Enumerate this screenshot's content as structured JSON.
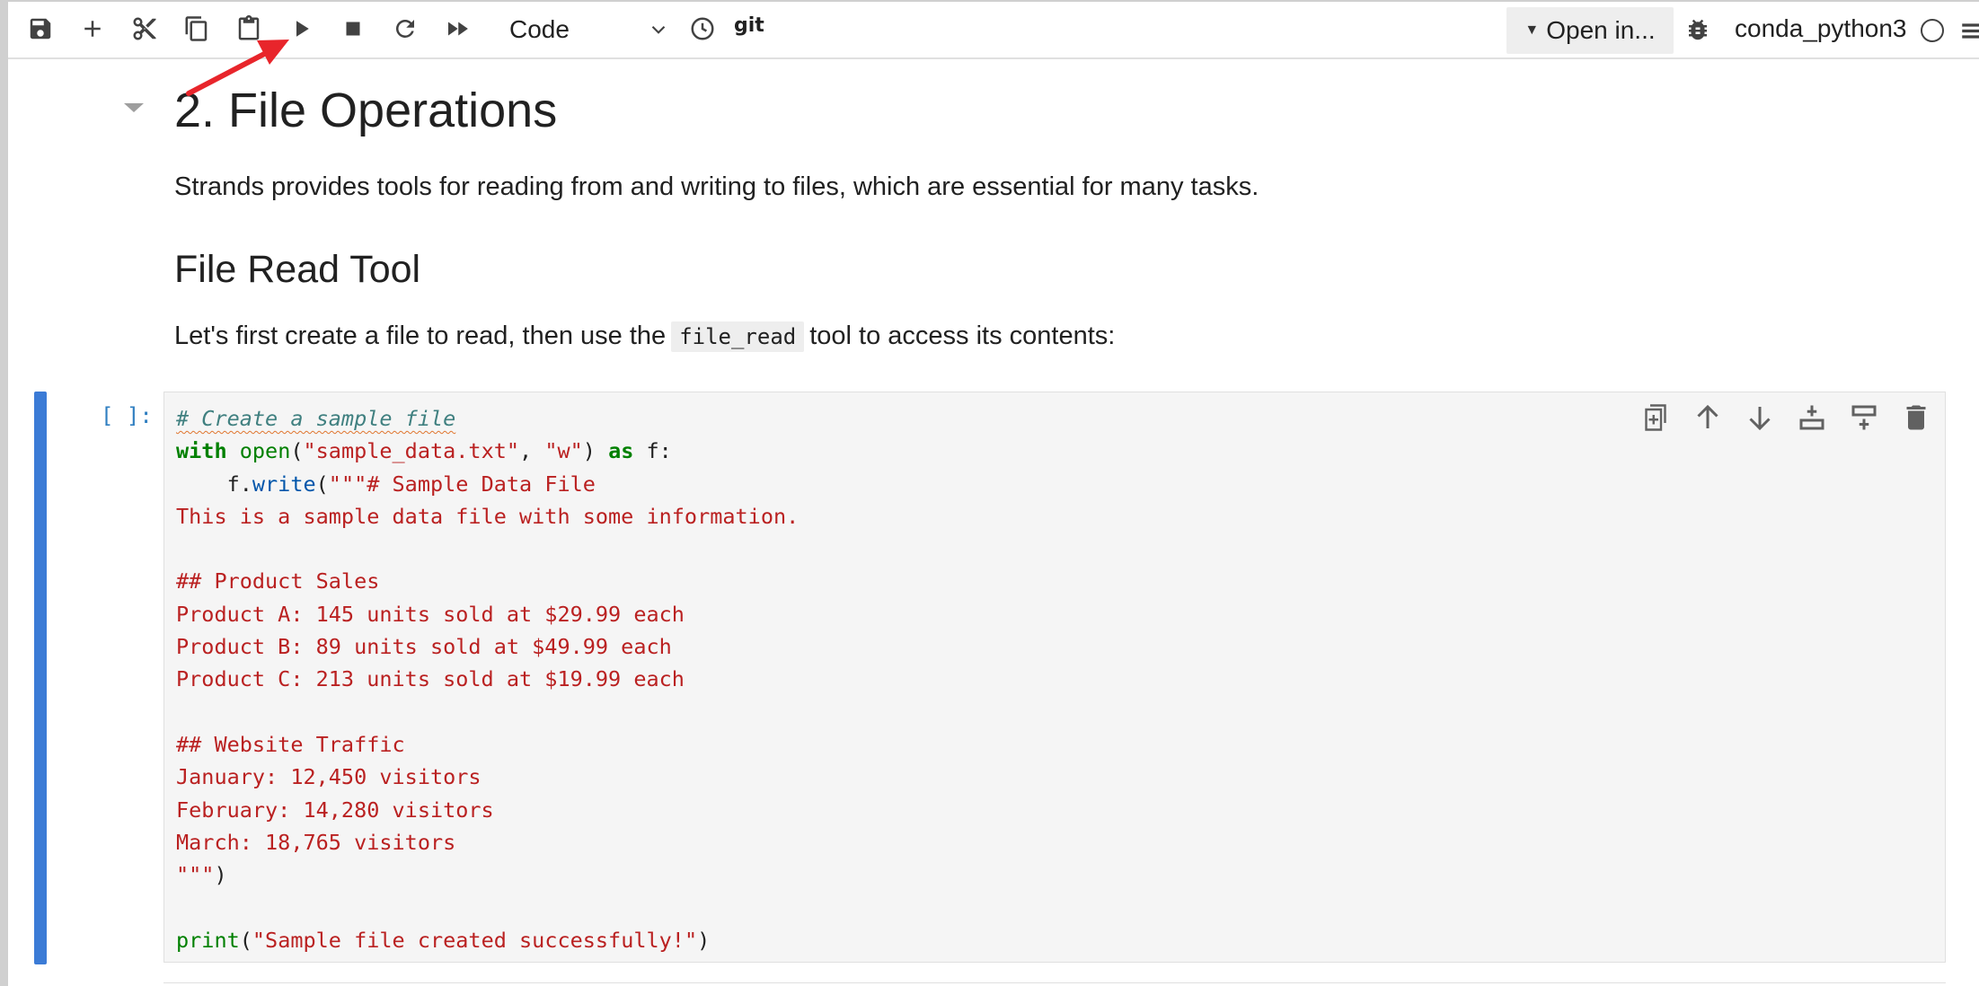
{
  "toolbar": {
    "cell_type_selected": "Code",
    "git_label": "git",
    "open_in_label": "Open in...",
    "kernel_name": "conda_python3",
    "icons": [
      "save-icon",
      "add-icon",
      "cut-icon",
      "copy-icon",
      "paste-icon",
      "run-icon",
      "stop-icon",
      "restart-icon",
      "fast-forward-icon",
      "chevron-down-icon",
      "clock-icon",
      "bug-icon",
      "kernel-status-icon",
      "menu-icon"
    ]
  },
  "markdown": {
    "heading": "2. File Operations",
    "intro": "Strands provides tools for reading from and writing to files, which are essential for many tasks.",
    "subheading": "File Read Tool",
    "para_before": "Let's first create a file to read, then use the",
    "inline_code": "file_read",
    "para_after": "tool to access its contents:"
  },
  "code_cell": {
    "prompt": "[ ]:",
    "lines": [
      "# Create a sample file",
      "with open(\"sample_data.txt\", \"w\") as f:",
      "    f.write(\"\"\"# Sample Data File",
      "This is a sample data file with some information.",
      "",
      "## Product Sales",
      "Product A: 145 units sold at $29.99 each",
      "Product B: 89 units sold at $49.99 each",
      "Product C: 213 units sold at $19.99 each",
      "",
      "## Website Traffic",
      "January: 12,450 visitors",
      "February: 14,280 visitors",
      "March: 18,765 visitors",
      "\"\"\")",
      "",
      "print(\"Sample file created successfully!\")"
    ],
    "tool_icons": [
      "duplicate-icon",
      "move-up-icon",
      "move-down-icon",
      "insert-above-icon",
      "insert-below-icon",
      "delete-icon"
    ]
  },
  "colors": {
    "active_cell_bar": "#3b7bd6",
    "prompt": "#307fc1",
    "annotation_arrow": "#e8252b",
    "string": "#ba2121",
    "keyword": "#008000"
  }
}
